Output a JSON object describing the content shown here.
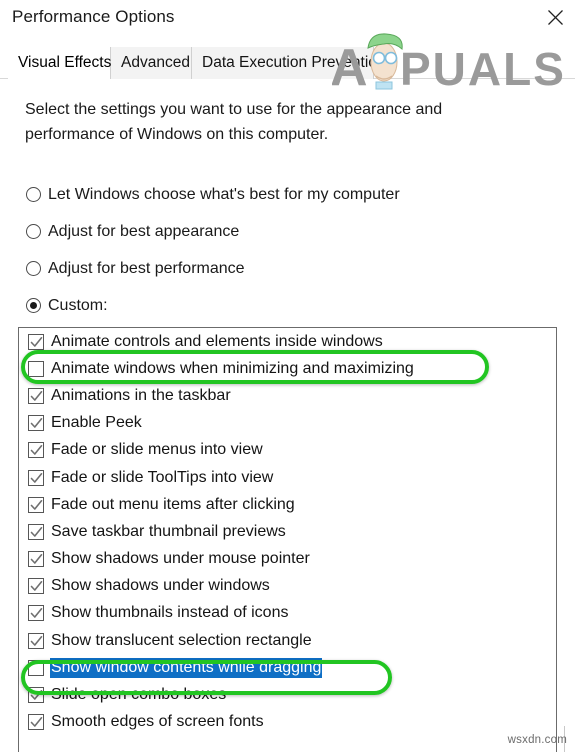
{
  "window": {
    "title": "Performance Options",
    "close_icon": "close-icon"
  },
  "tabs": [
    {
      "label": "Visual Effects",
      "active": true
    },
    {
      "label": "Advanced",
      "active": false
    },
    {
      "label": "Data Execution Prevention",
      "active": false
    }
  ],
  "intro": "Select the settings you want to use for the appearance and performance of Windows on this computer.",
  "radios": [
    {
      "label": "Let Windows choose what's best for my computer",
      "checked": false
    },
    {
      "label": "Adjust for best appearance",
      "checked": false
    },
    {
      "label": "Adjust for best performance",
      "checked": false
    },
    {
      "label": "Custom:",
      "checked": true
    }
  ],
  "options": [
    {
      "label": "Animate controls and elements inside windows",
      "checked": true,
      "selected": false
    },
    {
      "label": "Animate windows when minimizing and maximizing",
      "checked": false,
      "selected": false
    },
    {
      "label": "Animations in the taskbar",
      "checked": true,
      "selected": false
    },
    {
      "label": "Enable Peek",
      "checked": true,
      "selected": false
    },
    {
      "label": "Fade or slide menus into view",
      "checked": true,
      "selected": false
    },
    {
      "label": "Fade or slide ToolTips into view",
      "checked": true,
      "selected": false
    },
    {
      "label": "Fade out menu items after clicking",
      "checked": true,
      "selected": false
    },
    {
      "label": "Save taskbar thumbnail previews",
      "checked": true,
      "selected": false
    },
    {
      "label": "Show shadows under mouse pointer",
      "checked": true,
      "selected": false
    },
    {
      "label": "Show shadows under windows",
      "checked": true,
      "selected": false
    },
    {
      "label": "Show thumbnails instead of icons",
      "checked": true,
      "selected": false
    },
    {
      "label": "Show translucent selection rectangle",
      "checked": true,
      "selected": false
    },
    {
      "label": "Show window contents while dragging",
      "checked": false,
      "selected": true
    },
    {
      "label": "Slide open combo boxes",
      "checked": true,
      "selected": false
    },
    {
      "label": "Smooth edges of screen fonts",
      "checked": true,
      "selected": false
    }
  ],
  "annotations": [
    {
      "name": "highlight-animate-windows",
      "shape": "oval",
      "color": "#22c522"
    },
    {
      "name": "highlight-show-window-contents",
      "shape": "oval",
      "color": "#22c522"
    }
  ],
  "watermarks": {
    "logo_text": "PPUALS",
    "logo_letter": "A",
    "footer": "wsxdn.com"
  },
  "colors": {
    "selection_blue": "#0f6fc5",
    "annotation_green": "#22c522",
    "watermark_gray": "#9a9a9a"
  }
}
